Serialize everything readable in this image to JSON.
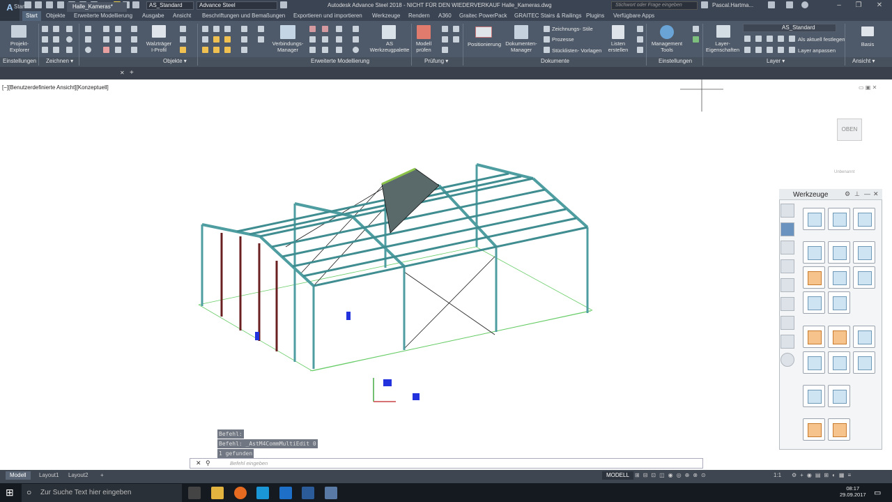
{
  "app": {
    "title": "Autodesk Advance Steel 2018 - NICHT FÜR DEN WIEDERVERKAUF   Halle_Kameras.dwg",
    "search_placeholder": "Stichwort oder Frage eingeben",
    "user": "Pascal.Hartma...",
    "workspace": "AS_Standard",
    "product": "Advance Steel",
    "logo": "A"
  },
  "ribbon_tabs": [
    "Start",
    "Objekte",
    "Erweiterte Modellierung",
    "Ausgabe",
    "Ansicht",
    "Beschriftungen und Bemaßungen",
    "Exportieren und importieren",
    "Werkzeuge",
    "Rendern",
    "A360",
    "Graitec PowerPack",
    "GRAITEC Stairs & Railings",
    "Plugins",
    "Verfügbare Apps"
  ],
  "ribbon": {
    "projekt_explorer": "Projekt-\nExplorer",
    "walztraeger": "Walzträger\nI-Profil",
    "verbindungs_manager": "Verbindungs-\nManager",
    "as_werkzeugpalette": "AS\nWerkzeugpalette",
    "modell_pruefen": "Modell\nprüfen",
    "positionierung": "Positionierung",
    "dokumenten_manager": "Dokumenten-\nManager",
    "zeichnungsstile": "Zeichnungs- Stile",
    "prozesse": "Prozesse",
    "stuecklisten": "Stücklisten- Vorlagen",
    "listen_erstellen": "Listen\nerstellen",
    "management_tools": "Management\nTools",
    "layer_eigenschaften": "Layer-\nEigenschaften",
    "layer_name": "AS_Standard",
    "als_aktuell": "Als aktuell festlegen",
    "layer_anpassen": "Layer anpassen",
    "basis": "Basis"
  },
  "panels": {
    "einstellungen": "Einstellungen",
    "zeichnen": "Zeichnen ▾",
    "objekte": "Objekte ▾",
    "erweiterte": "Erweiterte Modellierung",
    "pruefung": "Prüfung ▾",
    "dokumente": "Dokumente",
    "einstellungen2": "Einstellungen",
    "layer": "Layer ▾",
    "ansicht": "Ansicht ▾"
  },
  "doc_tabs": [
    "Start",
    "Halle_Kameras*"
  ],
  "viewport": {
    "label": "[−][Benutzerdefinierte Ansicht][Konzeptuell]",
    "viewcube": "OBEN",
    "unnamed": "Unbenannt"
  },
  "tool_palette": {
    "title": "Werkzeuge"
  },
  "command": {
    "history": [
      "Befehl:",
      "Befehl: _AstM4CommMultiEdit 0",
      "1 gefunden"
    ],
    "placeholder": "Befehl eingeben"
  },
  "status": {
    "tabs": [
      "Modell",
      "Layout1",
      "Layout2"
    ],
    "model": "MODELL",
    "scale": "1:1"
  },
  "taskbar": {
    "search": "Zur Suche Text hier eingeben",
    "time": "08:17",
    "date": "29.09.2017"
  }
}
